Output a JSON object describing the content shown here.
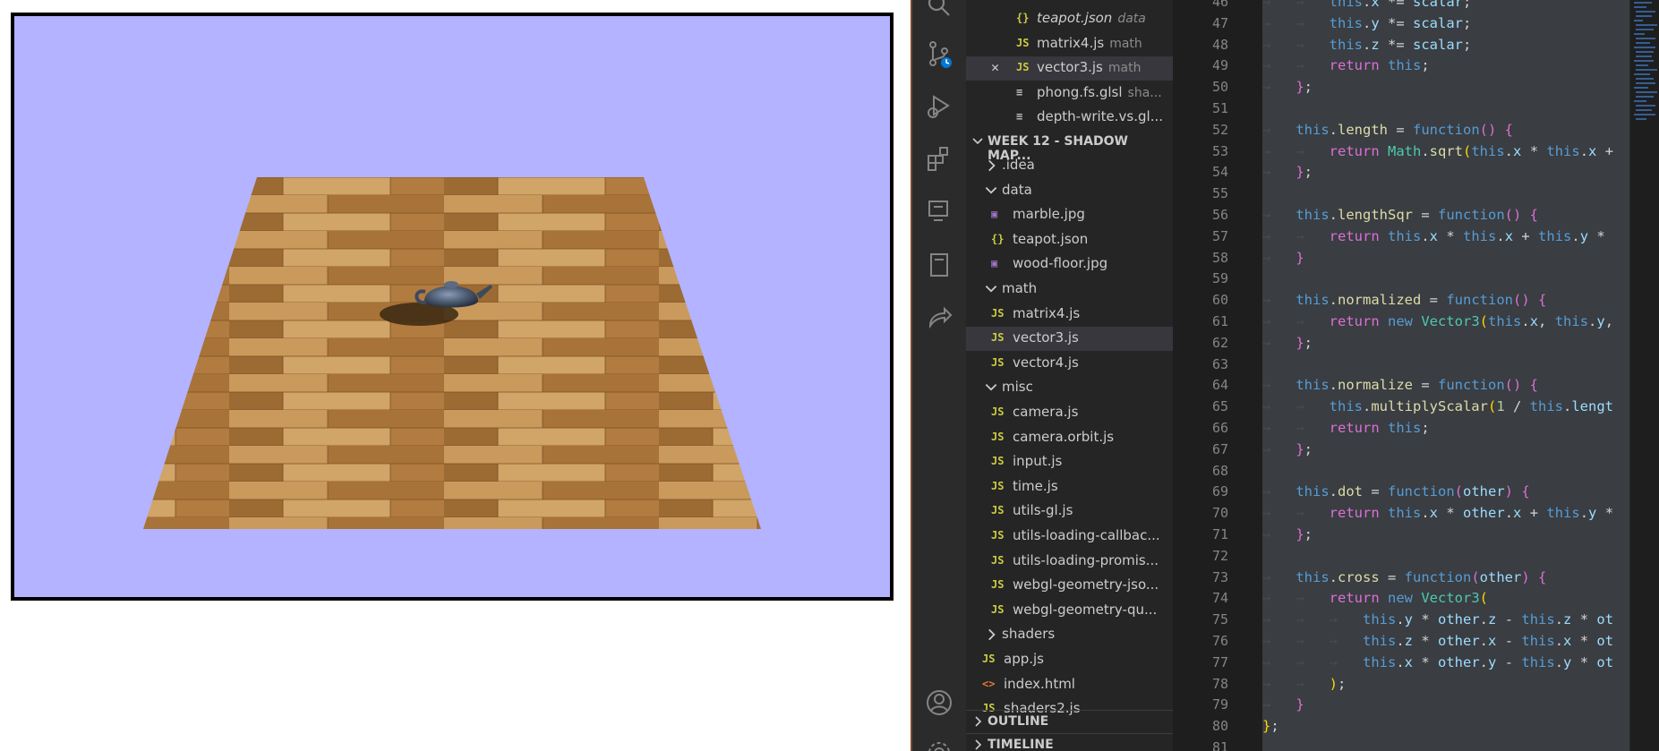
{
  "canvas": {
    "sky_color": "#b3b3ff",
    "floor_name": "wood-floor",
    "object_name": "teapot"
  },
  "sidebar": {
    "open_editors": [
      {
        "label": "teapot.json",
        "desc": "data",
        "icon": "json",
        "italic": true
      },
      {
        "label": "matrix4.js",
        "desc": "math",
        "icon": "js"
      },
      {
        "label": "vector3.js",
        "desc": "math",
        "icon": "js",
        "active": true
      },
      {
        "label": "phong.fs.glsl",
        "desc": "sha...",
        "icon": "glsl"
      },
      {
        "label": "depth-write.vs.gl...",
        "desc": "",
        "icon": "glsl"
      }
    ],
    "workspace_title": "WEEK 12 - SHADOW MAP...",
    "tree": [
      {
        "label": ".idea",
        "kind": "folder",
        "open": false,
        "depth": 1
      },
      {
        "label": "data",
        "kind": "folder",
        "open": true,
        "depth": 1
      },
      {
        "label": "marble.jpg",
        "kind": "img",
        "depth": 2
      },
      {
        "label": "teapot.json",
        "kind": "json",
        "depth": 2
      },
      {
        "label": "wood-floor.jpg",
        "kind": "img",
        "depth": 2
      },
      {
        "label": "math",
        "kind": "folder",
        "open": true,
        "depth": 1
      },
      {
        "label": "matrix4.js",
        "kind": "js",
        "depth": 2
      },
      {
        "label": "vector3.js",
        "kind": "js",
        "depth": 2,
        "selected": true
      },
      {
        "label": "vector4.js",
        "kind": "js",
        "depth": 2
      },
      {
        "label": "misc",
        "kind": "folder",
        "open": true,
        "depth": 1
      },
      {
        "label": "camera.js",
        "kind": "js",
        "depth": 2
      },
      {
        "label": "camera.orbit.js",
        "kind": "js",
        "depth": 2
      },
      {
        "label": "input.js",
        "kind": "js",
        "depth": 2
      },
      {
        "label": "time.js",
        "kind": "js",
        "depth": 2
      },
      {
        "label": "utils-gl.js",
        "kind": "js",
        "depth": 2
      },
      {
        "label": "utils-loading-callbac...",
        "kind": "js",
        "depth": 2
      },
      {
        "label": "utils-loading-promis...",
        "kind": "js",
        "depth": 2
      },
      {
        "label": "webgl-geometry-jso...",
        "kind": "js",
        "depth": 2
      },
      {
        "label": "webgl-geometry-qu...",
        "kind": "js",
        "depth": 2
      },
      {
        "label": "shaders",
        "kind": "folder",
        "open": false,
        "depth": 1
      },
      {
        "label": "app.js",
        "kind": "js",
        "depth": 1
      },
      {
        "label": "index.html",
        "kind": "html",
        "depth": 1
      },
      {
        "label": "shaders2.js",
        "kind": "js",
        "depth": 1
      }
    ],
    "outline_label": "OUTLINE",
    "timeline_label": "TIMELINE"
  },
  "editor": {
    "line_numbers": [
      "46",
      "47",
      "48",
      "49",
      "50",
      "51",
      "52",
      "53",
      "54",
      "55",
      "56",
      "57",
      "58",
      "59",
      "60",
      "61",
      "62",
      "63",
      "64",
      "65",
      "66",
      "67",
      "68",
      "69",
      "70",
      "71",
      "72",
      "73",
      "74",
      "75",
      "76",
      "77",
      "78",
      "79",
      "80",
      "81"
    ],
    "lines": [
      [
        [
          "ws",
          "→   →   "
        ],
        [
          "kw",
          "this"
        ],
        [
          "op",
          "."
        ],
        [
          "pr",
          "x"
        ],
        [
          "op",
          " *= "
        ],
        [
          "pr",
          "scalar"
        ],
        [
          "op",
          ";"
        ]
      ],
      [
        [
          "ws",
          "→   →   "
        ],
        [
          "kw",
          "this"
        ],
        [
          "op",
          "."
        ],
        [
          "pr",
          "y"
        ],
        [
          "op",
          " *= "
        ],
        [
          "pr",
          "scalar"
        ],
        [
          "op",
          ";"
        ]
      ],
      [
        [
          "ws",
          "→   →   "
        ],
        [
          "kw",
          "this"
        ],
        [
          "op",
          "."
        ],
        [
          "pr",
          "z"
        ],
        [
          "op",
          " *= "
        ],
        [
          "pr",
          "scalar"
        ],
        [
          "op",
          ";"
        ]
      ],
      [
        [
          "ws",
          "→   →   "
        ],
        [
          "br1",
          "return"
        ],
        [
          "op",
          " "
        ],
        [
          "kw",
          "this"
        ],
        [
          "op",
          ";"
        ]
      ],
      [
        [
          "ws",
          "→   "
        ],
        [
          "br1",
          "}"
        ],
        [
          "op",
          ";"
        ]
      ],
      [],
      [
        [
          "ws",
          "→   "
        ],
        [
          "kw",
          "this"
        ],
        [
          "op",
          "."
        ],
        [
          "fn",
          "length"
        ],
        [
          "op",
          " = "
        ],
        [
          "kw",
          "function"
        ],
        [
          "br1",
          "()"
        ],
        [
          "op",
          " "
        ],
        [
          "br1",
          "{"
        ]
      ],
      [
        [
          "ws",
          "→   →   "
        ],
        [
          "br1",
          "return"
        ],
        [
          "op",
          " "
        ],
        [
          "ty",
          "Math"
        ],
        [
          "op",
          "."
        ],
        [
          "fn",
          "sqrt"
        ],
        [
          "br2",
          "("
        ],
        [
          "kw",
          "this"
        ],
        [
          "op",
          "."
        ],
        [
          "pr",
          "x"
        ],
        [
          "op",
          " * "
        ],
        [
          "kw",
          "this"
        ],
        [
          "op",
          "."
        ],
        [
          "pr",
          "x"
        ],
        [
          "op",
          " +"
        ]
      ],
      [
        [
          "ws",
          "→   "
        ],
        [
          "br1",
          "}"
        ],
        [
          "op",
          ";"
        ]
      ],
      [],
      [
        [
          "ws",
          "→   "
        ],
        [
          "kw",
          "this"
        ],
        [
          "op",
          "."
        ],
        [
          "fn",
          "lengthSqr"
        ],
        [
          "op",
          " = "
        ],
        [
          "kw",
          "function"
        ],
        [
          "br1",
          "()"
        ],
        [
          "op",
          " "
        ],
        [
          "br1",
          "{"
        ]
      ],
      [
        [
          "ws",
          "→   →   "
        ],
        [
          "br1",
          "return"
        ],
        [
          "op",
          " "
        ],
        [
          "kw",
          "this"
        ],
        [
          "op",
          "."
        ],
        [
          "pr",
          "x"
        ],
        [
          "op",
          " * "
        ],
        [
          "kw",
          "this"
        ],
        [
          "op",
          "."
        ],
        [
          "pr",
          "x"
        ],
        [
          "op",
          " + "
        ],
        [
          "kw",
          "this"
        ],
        [
          "op",
          "."
        ],
        [
          "pr",
          "y"
        ],
        [
          "op",
          " *"
        ]
      ],
      [
        [
          "ws",
          "→   "
        ],
        [
          "br1",
          "}"
        ]
      ],
      [],
      [
        [
          "ws",
          "→   "
        ],
        [
          "kw",
          "this"
        ],
        [
          "op",
          "."
        ],
        [
          "fn",
          "normalized"
        ],
        [
          "op",
          " = "
        ],
        [
          "kw",
          "function"
        ],
        [
          "br1",
          "()"
        ],
        [
          "op",
          " "
        ],
        [
          "br1",
          "{"
        ]
      ],
      [
        [
          "ws",
          "→   →   "
        ],
        [
          "br1",
          "return"
        ],
        [
          "op",
          " "
        ],
        [
          "kw",
          "new"
        ],
        [
          "op",
          " "
        ],
        [
          "ty",
          "Vector3"
        ],
        [
          "br2",
          "("
        ],
        [
          "kw",
          "this"
        ],
        [
          "op",
          "."
        ],
        [
          "pr",
          "x"
        ],
        [
          "op",
          ", "
        ],
        [
          "kw",
          "this"
        ],
        [
          "op",
          "."
        ],
        [
          "pr",
          "y"
        ],
        [
          "op",
          ","
        ]
      ],
      [
        [
          "ws",
          "→   "
        ],
        [
          "br1",
          "}"
        ],
        [
          "op",
          ";"
        ]
      ],
      [],
      [
        [
          "ws",
          "→   "
        ],
        [
          "kw",
          "this"
        ],
        [
          "op",
          "."
        ],
        [
          "fn",
          "normalize"
        ],
        [
          "op",
          " = "
        ],
        [
          "kw",
          "function"
        ],
        [
          "br1",
          "()"
        ],
        [
          "op",
          " "
        ],
        [
          "br1",
          "{"
        ]
      ],
      [
        [
          "ws",
          "→   →   "
        ],
        [
          "kw",
          "this"
        ],
        [
          "op",
          "."
        ],
        [
          "fn",
          "multiplyScalar"
        ],
        [
          "br2",
          "("
        ],
        [
          "nm",
          "1"
        ],
        [
          "op",
          " / "
        ],
        [
          "kw",
          "this"
        ],
        [
          "op",
          "."
        ],
        [
          "pr",
          "lengt"
        ]
      ],
      [
        [
          "ws",
          "→   →   "
        ],
        [
          "br1",
          "return"
        ],
        [
          "op",
          " "
        ],
        [
          "kw",
          "this"
        ],
        [
          "op",
          ";"
        ]
      ],
      [
        [
          "ws",
          "→   "
        ],
        [
          "br1",
          "}"
        ],
        [
          "op",
          ";"
        ]
      ],
      [],
      [
        [
          "ws",
          "→   "
        ],
        [
          "kw",
          "this"
        ],
        [
          "op",
          "."
        ],
        [
          "fn",
          "dot"
        ],
        [
          "op",
          " = "
        ],
        [
          "kw",
          "function"
        ],
        [
          "br1",
          "("
        ],
        [
          "pr",
          "other"
        ],
        [
          "br1",
          ")"
        ],
        [
          "op",
          " "
        ],
        [
          "br1",
          "{"
        ]
      ],
      [
        [
          "ws",
          "→   →   "
        ],
        [
          "br1",
          "return"
        ],
        [
          "op",
          " "
        ],
        [
          "kw",
          "this"
        ],
        [
          "op",
          "."
        ],
        [
          "pr",
          "x"
        ],
        [
          "op",
          " * "
        ],
        [
          "pr",
          "other"
        ],
        [
          "op",
          "."
        ],
        [
          "pr",
          "x"
        ],
        [
          "op",
          " + "
        ],
        [
          "kw",
          "this"
        ],
        [
          "op",
          "."
        ],
        [
          "pr",
          "y"
        ],
        [
          "op",
          " *"
        ]
      ],
      [
        [
          "ws",
          "→   "
        ],
        [
          "br1",
          "}"
        ],
        [
          "op",
          ";"
        ]
      ],
      [],
      [
        [
          "ws",
          "→   "
        ],
        [
          "kw",
          "this"
        ],
        [
          "op",
          "."
        ],
        [
          "fn",
          "cross"
        ],
        [
          "op",
          " = "
        ],
        [
          "kw",
          "function"
        ],
        [
          "br1",
          "("
        ],
        [
          "pr",
          "other"
        ],
        [
          "br1",
          ")"
        ],
        [
          "op",
          " "
        ],
        [
          "br1",
          "{"
        ]
      ],
      [
        [
          "ws",
          "→   →   "
        ],
        [
          "br1",
          "return"
        ],
        [
          "op",
          " "
        ],
        [
          "kw",
          "new"
        ],
        [
          "op",
          " "
        ],
        [
          "ty",
          "Vector3"
        ],
        [
          "br2",
          "("
        ]
      ],
      [
        [
          "ws",
          "→   →   →   "
        ],
        [
          "kw",
          "this"
        ],
        [
          "op",
          "."
        ],
        [
          "pr",
          "y"
        ],
        [
          "op",
          " * "
        ],
        [
          "pr",
          "other"
        ],
        [
          "op",
          "."
        ],
        [
          "pr",
          "z"
        ],
        [
          "op",
          " - "
        ],
        [
          "kw",
          "this"
        ],
        [
          "op",
          "."
        ],
        [
          "pr",
          "z"
        ],
        [
          "op",
          " * "
        ],
        [
          "pr",
          "ot"
        ]
      ],
      [
        [
          "ws",
          "→   →   →   "
        ],
        [
          "kw",
          "this"
        ],
        [
          "op",
          "."
        ],
        [
          "pr",
          "z"
        ],
        [
          "op",
          " * "
        ],
        [
          "pr",
          "other"
        ],
        [
          "op",
          "."
        ],
        [
          "pr",
          "x"
        ],
        [
          "op",
          " - "
        ],
        [
          "kw",
          "this"
        ],
        [
          "op",
          "."
        ],
        [
          "pr",
          "x"
        ],
        [
          "op",
          " * "
        ],
        [
          "pr",
          "ot"
        ]
      ],
      [
        [
          "ws",
          "→   →   →   "
        ],
        [
          "kw",
          "this"
        ],
        [
          "op",
          "."
        ],
        [
          "pr",
          "x"
        ],
        [
          "op",
          " * "
        ],
        [
          "pr",
          "other"
        ],
        [
          "op",
          "."
        ],
        [
          "pr",
          "y"
        ],
        [
          "op",
          " - "
        ],
        [
          "kw",
          "this"
        ],
        [
          "op",
          "."
        ],
        [
          "pr",
          "y"
        ],
        [
          "op",
          " * "
        ],
        [
          "pr",
          "ot"
        ]
      ],
      [
        [
          "ws",
          "→   →   "
        ],
        [
          "br2",
          ")"
        ],
        [
          "op",
          ";"
        ]
      ],
      [
        [
          "ws",
          "→   "
        ],
        [
          "br1",
          "}"
        ]
      ],
      [
        [
          "br2",
          "}"
        ],
        [
          "op",
          ";"
        ]
      ],
      []
    ]
  }
}
